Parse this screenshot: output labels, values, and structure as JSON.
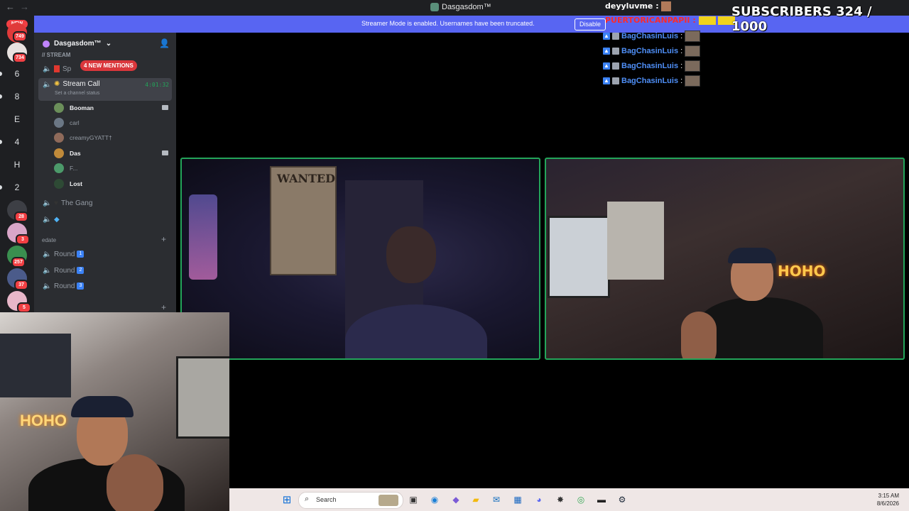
{
  "titlebar": {
    "title": "Dasgasdom™",
    "back": "←",
    "forward": "→"
  },
  "banner": {
    "message": "Streamer Mode is enabled. Usernames have been truncated.",
    "disable_label": "Disable",
    "close": "✕"
  },
  "rail": {
    "new_label": "NEW",
    "items": [
      {
        "label": "",
        "badge": "749"
      },
      {
        "label": "",
        "badge": "734"
      },
      {
        "label": "6",
        "badge": ""
      },
      {
        "label": "8",
        "badge": ""
      },
      {
        "label": "E",
        "badge": ""
      },
      {
        "label": "4",
        "badge": ""
      },
      {
        "label": "H",
        "badge": ""
      },
      {
        "label": "2",
        "badge": ""
      },
      {
        "label": "",
        "badge": "28"
      },
      {
        "label": "",
        "badge": "3"
      },
      {
        "label": "",
        "badge": "257"
      },
      {
        "label": "",
        "badge": "37"
      },
      {
        "label": "",
        "badge": "5"
      }
    ]
  },
  "sidebar": {
    "server_name": "Dasgasdom™",
    "category_top": "// STREAM",
    "mentions": "4 NEW MENTIONS",
    "partial_channel": "Sp",
    "stream_call": {
      "name": "Stream Call",
      "timer": "4:01:32",
      "status": "Set a channel status"
    },
    "voice_users": [
      {
        "name": "Booman",
        "bold": true,
        "camera": true
      },
      {
        "name": "carl",
        "bold": false,
        "camera": false
      },
      {
        "name": "creamyGYATT†",
        "bold": false,
        "camera": false
      },
      {
        "name": "Das",
        "bold": true,
        "camera": true
      },
      {
        "name": "F...",
        "bold": false,
        "camera": false
      },
      {
        "name": "Lost",
        "bold": true,
        "camera": false
      }
    ],
    "gang_channel": "The Gang",
    "category_edate": "edate",
    "rounds": [
      {
        "name": "Round",
        "num": "1"
      },
      {
        "name": "Round",
        "num": "2"
      },
      {
        "name": "Round",
        "num": "3"
      }
    ]
  },
  "tiles": {
    "wanted_text": "WANTED",
    "neon_text": "HOHO",
    "facecam_neon": "HOHO"
  },
  "overlay": {
    "subs": "SUBSCRIBERS 324 / 1000",
    "top_user": "deyyluvme :",
    "second_user": "PUERTORICANPAPII :",
    "chat": [
      {
        "name": "BagChasinLuis",
        "sep": ":"
      },
      {
        "name": "BagChasinLuis",
        "sep": ":"
      },
      {
        "name": "BagChasinLuis",
        "sep": ":"
      },
      {
        "name": "BagChasinLuis",
        "sep": ":"
      }
    ]
  },
  "taskbar": {
    "search_placeholder": "Search",
    "time": "3:15 AM",
    "date": "8/6/2026"
  },
  "colors": {
    "blurple": "#5865f2",
    "green": "#23a55a",
    "red": "#f23f43"
  }
}
